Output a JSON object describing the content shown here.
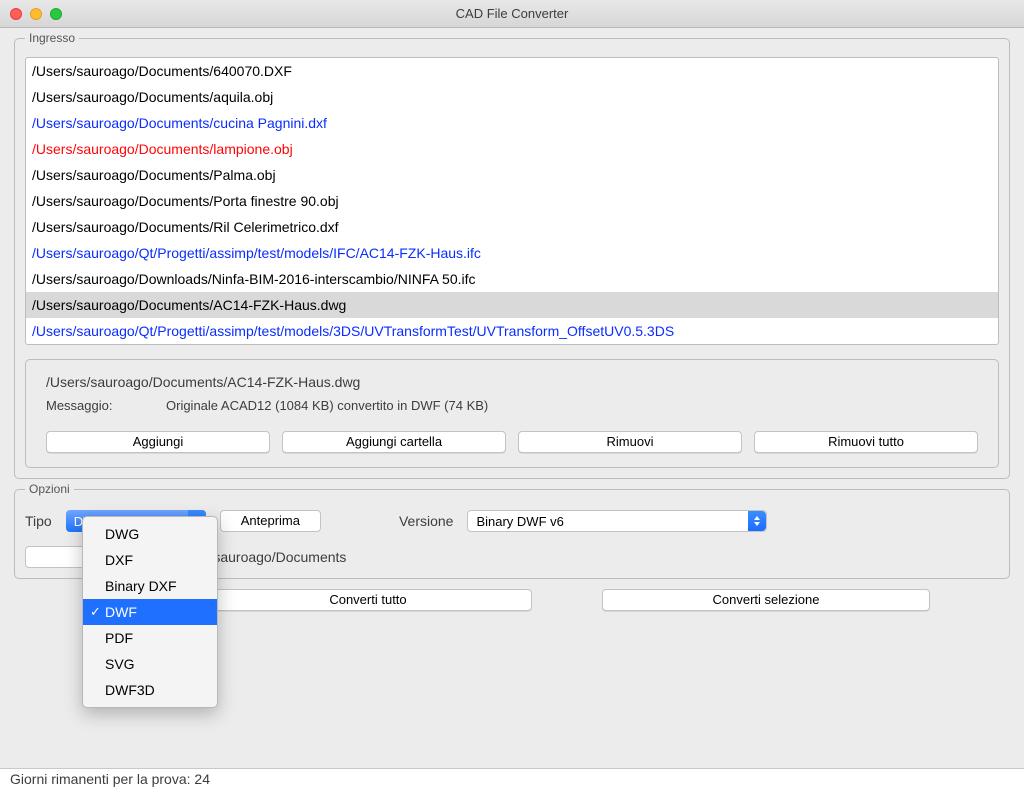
{
  "window": {
    "title": "CAD File Converter"
  },
  "ingresso": {
    "label": "Ingresso",
    "files": [
      {
        "path": "/Users/sauroago/Documents/640070.DXF",
        "color": "black",
        "selected": false
      },
      {
        "path": "/Users/sauroago/Documents/aquila.obj",
        "color": "black",
        "selected": false
      },
      {
        "path": "/Users/sauroago/Documents/cucina Pagnini.dxf",
        "color": "blue",
        "selected": false
      },
      {
        "path": "/Users/sauroago/Documents/lampione.obj",
        "color": "red",
        "selected": false
      },
      {
        "path": "/Users/sauroago/Documents/Palma.obj",
        "color": "black",
        "selected": false
      },
      {
        "path": "/Users/sauroago/Documents/Porta finestre 90.obj",
        "color": "black",
        "selected": false
      },
      {
        "path": "/Users/sauroago/Documents/Ril Celerimetrico.dxf",
        "color": "black",
        "selected": false
      },
      {
        "path": "/Users/sauroago/Qt/Progetti/assimp/test/models/IFC/AC14-FZK-Haus.ifc",
        "color": "blue",
        "selected": false
      },
      {
        "path": "/Users/sauroago/Downloads/Ninfa-BIM-2016-interscambio/NINFA 50.ifc",
        "color": "black",
        "selected": false
      },
      {
        "path": "/Users/sauroago/Documents/AC14-FZK-Haus.dwg",
        "color": "black",
        "selected": true
      },
      {
        "path": "/Users/sauroago/Qt/Progetti/assimp/test/models/3DS/UVTransformTest/UVTransform_OffsetUV0.5.3DS",
        "color": "blue",
        "selected": false
      }
    ],
    "info": {
      "path": "/Users/sauroago/Documents/AC14-FZK-Haus.dwg",
      "message_label": "Messaggio:",
      "message_value": "Originale ACAD12 (1084 KB) convertito in DWF (74 KB)"
    },
    "buttons": {
      "add": "Aggiungi",
      "add_folder": "Aggiungi cartella",
      "remove": "Rimuovi",
      "remove_all": "Rimuovi tutto"
    }
  },
  "opzioni": {
    "label": "Opzioni",
    "tipo_label": "Tipo",
    "tipo_value": "DWF",
    "anteprima": "Anteprima",
    "versione_label": "Versione",
    "versione_value": "Binary DWF v6",
    "s_button": "S",
    "output_path": "/Users/sauroago/Documents"
  },
  "dropdown": {
    "items": [
      {
        "label": "DWG",
        "selected": false
      },
      {
        "label": "DXF",
        "selected": false
      },
      {
        "label": "Binary DXF",
        "selected": false
      },
      {
        "label": "DWF",
        "selected": true
      },
      {
        "label": "PDF",
        "selected": false
      },
      {
        "label": "SVG",
        "selected": false
      },
      {
        "label": "DWF3D",
        "selected": false
      }
    ]
  },
  "convert": {
    "all": "Converti tutto",
    "selection": "Converti selezione"
  },
  "status": "Giorni rimanenti per la prova: 24"
}
